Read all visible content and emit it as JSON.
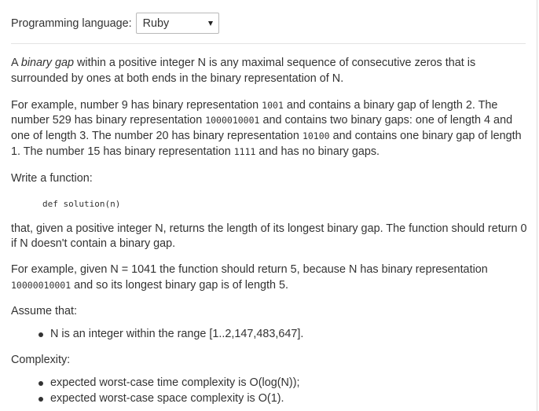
{
  "language_bar": {
    "label": "Programming language:",
    "selected": "Ruby"
  },
  "task": {
    "intro": {
      "pre": "A ",
      "term": "binary gap",
      "post": " within a positive integer N is any maximal sequence of consecutive zeros that is surrounded by ones at both ends in the binary representation of N."
    },
    "example1": {
      "t1": "For example, number 9 has binary representation ",
      "c1": "1001",
      "t2": " and contains a binary gap of length 2. The number 529 has binary representation ",
      "c2": "1000010001",
      "t3": " and contains two binary gaps: one of length 4 and one of length 3. The number 20 has binary representation ",
      "c3": "10100",
      "t4": " and contains one binary gap of length 1. The number 15 has binary representation ",
      "c4": "1111",
      "t5": " and has no binary gaps."
    },
    "write_function": "Write a function:",
    "signature": "def solution(n)",
    "description": "that, given a positive integer N, returns the length of its longest binary gap. The function should return 0 if N doesn't contain a binary gap.",
    "example2": {
      "t1": "For example, given N = 1041 the function should return 5, because N has binary representation ",
      "c1": "10000010001",
      "t2": " and so its longest binary gap is of length 5."
    },
    "assume_heading": "Assume that:",
    "assumptions": [
      "N is an integer within the range [1..2,147,483,647]."
    ],
    "complexity_heading": "Complexity:",
    "complexity": [
      "expected worst-case time complexity is O(log(N));",
      "expected worst-case space complexity is O(1)."
    ]
  }
}
